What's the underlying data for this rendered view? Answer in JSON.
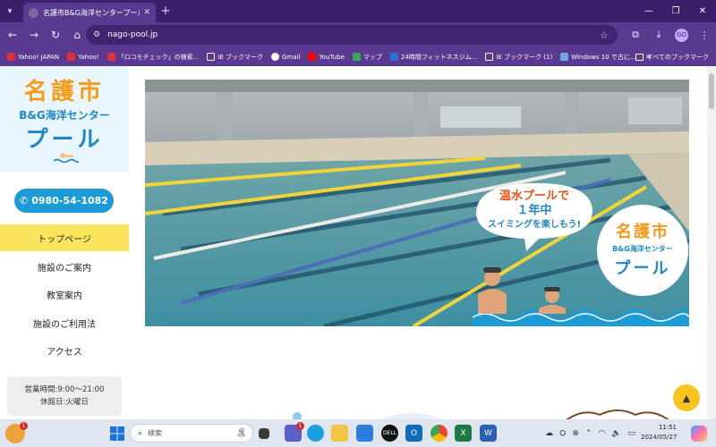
{
  "browser": {
    "tab_title": "名護市B&G海洋センタープール | 沖",
    "url": "nago-pool.jp",
    "profile_initials": "GO",
    "bookmarks": [
      {
        "label": "Yahoo! JAPAN",
        "color": "#e0313a"
      },
      {
        "label": "Yahoo!",
        "color": "#e0313a"
      },
      {
        "label": "「ロコモチェック」の検索...",
        "color": "#e0313a"
      },
      {
        "label": "IE ブックマーク",
        "color": "#f2c14e"
      },
      {
        "label": "Gmail",
        "color": "#ffffff"
      },
      {
        "label": "YouTube",
        "color": "#ff0000"
      },
      {
        "label": "マップ",
        "color": "#34a853"
      },
      {
        "label": "24時間フィットネスジム...",
        "color": "#2d6fd6"
      },
      {
        "label": "IE ブックマーク (1)",
        "color": "#f2c14e"
      },
      {
        "label": "Windows 10 で古に...",
        "color": "#6aa6e8"
      }
    ],
    "all_bookmarks_label": "すべてのブックマーク"
  },
  "site": {
    "logo_line1": "名護市",
    "logo_line2": "B&G海洋センター",
    "logo_line3": "プール",
    "phone": "0980-54-1082",
    "menu": [
      {
        "label": "トップページ",
        "active": true
      },
      {
        "label": "施設のご案内",
        "active": false
      },
      {
        "label": "教室案内",
        "active": false
      },
      {
        "label": "施設のご利用法",
        "active": false
      },
      {
        "label": "アクセス",
        "active": false
      }
    ],
    "hours_line1": "営業時間:9:00〜21:00",
    "hours_line2": "休館日:火曜日"
  },
  "hero": {
    "bubble_line1": "温水プールで",
    "bubble_line2": "１年中",
    "bubble_line3": "スイミングを楽しもう!",
    "badge_line1": "名護市",
    "badge_line2": "B&G海洋センター",
    "badge_line3": "プール"
  },
  "taskbar": {
    "search_placeholder": "検索",
    "time": "11:51",
    "date": "2024/05/27",
    "notification_count": "1",
    "chat_badge": "1"
  },
  "colors": {
    "accent_orange": "#f49b19",
    "accent_blue": "#1d86c6",
    "active_menu": "#fbe55e",
    "browser_chrome": "#5a3a91"
  }
}
